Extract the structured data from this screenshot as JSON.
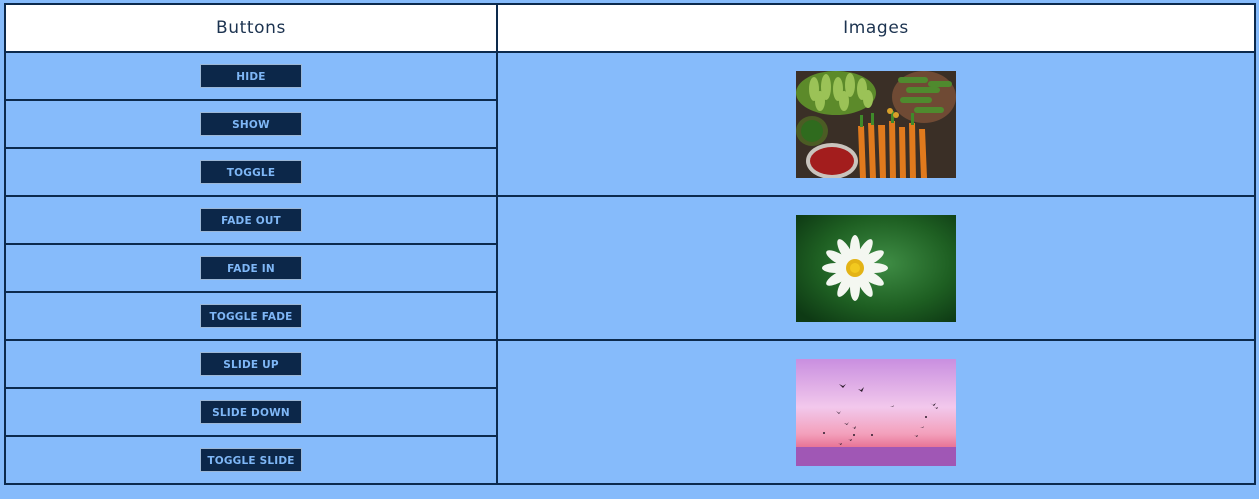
{
  "table": {
    "headers": {
      "buttons": "Buttons",
      "images": "Images"
    },
    "groups": [
      {
        "buttons": [
          "HIDE",
          "SHOW",
          "TOGGLE"
        ],
        "image": "vegetables-image"
      },
      {
        "buttons": [
          "FADE OUT",
          "FADE IN",
          "TOGGLE FADE"
        ],
        "image": "daisy-flower-image"
      },
      {
        "buttons": [
          "SLIDE UP",
          "SLIDE DOWN",
          "TOGGLE SLIDE"
        ],
        "image": "birds-sunset-image"
      }
    ]
  },
  "colors": {
    "page_bg": "#86bbfb",
    "header_bg": "#ffffff",
    "button_bg": "#0c2749",
    "button_text": "#7fb7f6",
    "border": "#0c2a4d"
  }
}
